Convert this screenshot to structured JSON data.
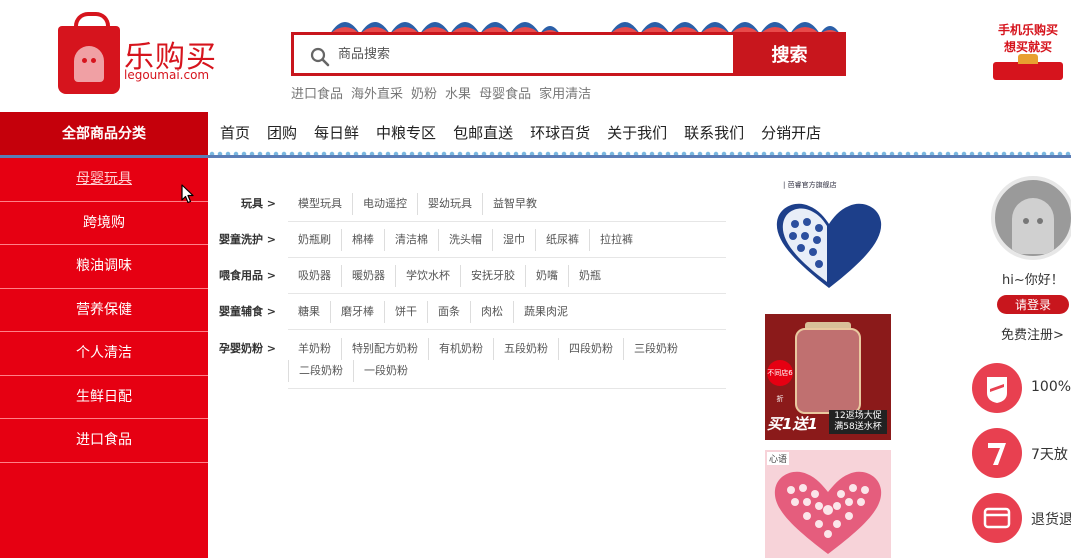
{
  "logo": {
    "cn": "乐购买",
    "en": "legoumai.com"
  },
  "search": {
    "placeholder": "商品搜索",
    "button": "搜索"
  },
  "hot_words": [
    "进口食品",
    "海外直采",
    "奶粉",
    "水果",
    "母婴食品",
    "家用清洁"
  ],
  "promo": {
    "line1": "手机乐购买",
    "line2": "想买就买"
  },
  "nav": {
    "all_categories": "全部商品分类",
    "links": [
      "首页",
      "团购",
      "每日鲜",
      "中粮专区",
      "包邮直送",
      "环球百货",
      "关于我们",
      "联系我们",
      "分销开店"
    ]
  },
  "sidebar": {
    "items": [
      "母婴玩具",
      "跨境购",
      "粮油调味",
      "营养保健",
      "个人清洁",
      "生鲜日配",
      "进口食品"
    ]
  },
  "categories": [
    {
      "title": "玩具 >",
      "items": [
        "模型玩具",
        "电动遥控",
        "婴幼玩具",
        "益智早教"
      ]
    },
    {
      "title": "婴童洗护 >",
      "items": [
        "奶瓶刷",
        "棉棒",
        "清洁棉",
        "洗头帽",
        "湿巾",
        "纸尿裤",
        "拉拉裤"
      ]
    },
    {
      "title": "喂食用品 >",
      "items": [
        "吸奶器",
        "暖奶器",
        "学饮水杯",
        "安抚牙胶",
        "奶嘴",
        "奶瓶"
      ]
    },
    {
      "title": "婴童辅食 >",
      "items": [
        "糖果",
        "磨牙棒",
        "饼干",
        "面条",
        "肉松",
        "蔬果肉泥"
      ]
    },
    {
      "title": "孕婴奶粉 >",
      "items": [
        "羊奶粉",
        "特别配方奶粉",
        "有机奶粉",
        "五段奶粉",
        "四段奶粉",
        "三段奶粉",
        "二段奶粉",
        "一段奶粉"
      ]
    }
  ],
  "ads": {
    "ad1_label": "| 芭睿官方旗舰店",
    "ad2_main": "买1送1",
    "ad2_badge": "不同店6折",
    "ad2_sub": "12返场大促 满58送水杯",
    "ad3_label": "心语"
  },
  "user": {
    "greeting": "hi~你好！",
    "login": "请登录",
    "register": "免费注册>"
  },
  "services": [
    "100%",
    "7天放",
    "退货退"
  ],
  "colors": {
    "brand_red": "#c8161d",
    "sidebar_red": "#e60012",
    "nav_blue": "#5b7db6"
  }
}
